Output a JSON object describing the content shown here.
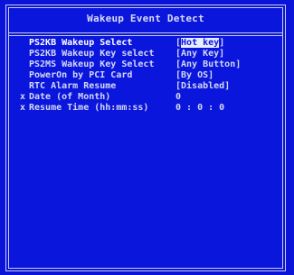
{
  "window": {
    "title": "Wakeup Event Detect"
  },
  "settings": [
    {
      "mark": "",
      "label": "PS2KB Wakeup Select",
      "value_prefix": "[",
      "value_selected": "Hot key",
      "value_suffix": "]",
      "highlight": true
    },
    {
      "mark": "",
      "label": "PS2KB Wakeup Key select",
      "value_prefix": "",
      "value_selected": "",
      "value_suffix": "[Any Key]"
    },
    {
      "mark": "",
      "label": "PS2MS Wakeup Key Select",
      "value_prefix": "",
      "value_selected": "",
      "value_suffix": "[Any Button]"
    },
    {
      "mark": "",
      "label": "PowerOn by PCI Card",
      "value_prefix": "",
      "value_selected": "",
      "value_suffix": "[By OS]"
    },
    {
      "mark": "",
      "label": "RTC Alarm Resume",
      "value_prefix": "",
      "value_selected": "",
      "value_suffix": "[Disabled]"
    },
    {
      "mark": "x",
      "label": "Date (of Month)",
      "value_prefix": "",
      "value_selected": "",
      "value_suffix": "  0"
    },
    {
      "mark": "x",
      "label": "Resume Time (hh:mm:ss)",
      "value_prefix": "",
      "value_selected": "",
      "value_suffix": " 0 :  0 :  0"
    }
  ]
}
